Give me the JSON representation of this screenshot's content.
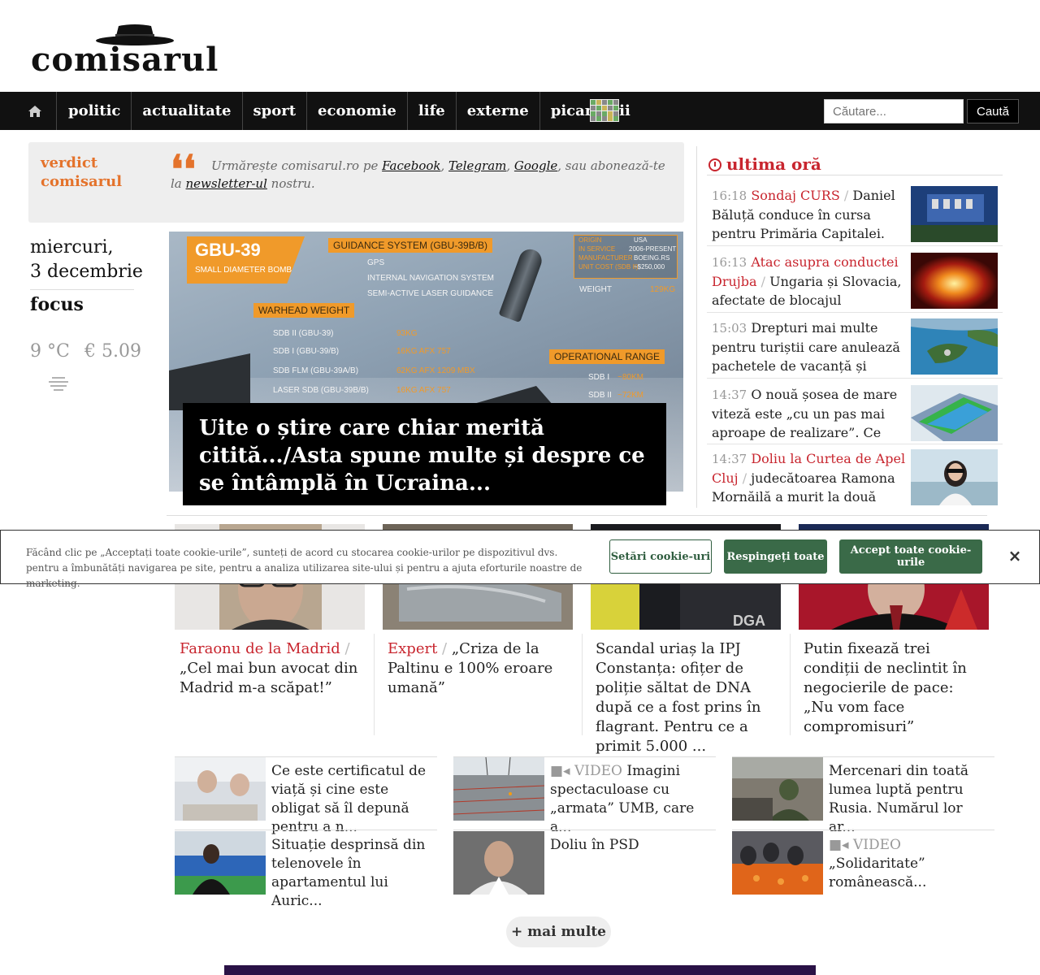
{
  "header": {
    "logo_text": "comisarul"
  },
  "nav": {
    "home_icon": "home-icon",
    "items": [
      "politic",
      "actualitate",
      "sport",
      "economie",
      "life",
      "externe",
      "picanterii"
    ],
    "wordle_icon": "wordle-grid-icon",
    "search_placeholder": "Căutare...",
    "search_button": "Caută"
  },
  "verdict": {
    "title": "verdict comisarul",
    "text_prefix": "Urmărește comisarul.ro pe ",
    "link_facebook": "Facebook",
    "sep1": ", ",
    "link_telegram": "Telegram",
    "sep2": ", ",
    "link_google": "Google",
    "text_mid": ", sau abonează-te la ",
    "link_newsletter": "newsletter-ul",
    "text_suffix": " nostru."
  },
  "sidebar_left": {
    "day": "miercuri,",
    "date": "3 decembrie",
    "focus": "focus",
    "temperature": "9 °C",
    "euro": "€ 5.09",
    "weather_icon": "fog-icon"
  },
  "hero": {
    "caption": "Uite o știre care chiar merită citită.../Asta spune multe și despre ce se întâmplă în Ucraina...",
    "infographic": {
      "title": "GBU-39",
      "subtitle": "SMALL DIAMETER BOMB",
      "guidance": "GUIDANCE SYSTEM (GBU-39B/B)",
      "gps": "GPS",
      "ins": "INTERNAL NAVIGATION SYSTEM",
      "laser": "SEMI-ACTIVE LASER GUIDANCE",
      "warhead": "WARHEAD WEIGHT",
      "sdb2": "SDB II (GBU-39)",
      "sdb1": "SDB I (GBU-39/B)",
      "sdbflm": "SDB FLM (GBU-39A/B)",
      "lasersdb": "LASER SDB (GBU-39B/B)",
      "w1": "93KG",
      "w2": "16KG AFX 757",
      "w3": "62KG AFX 1209 MBX",
      "w4": "16KG AFX 757",
      "range": "OPERATIONAL RANGE",
      "r1": "SDB I",
      "r2": "SDB II",
      "r1v": "~80KM",
      "r2v": "~72KM",
      "origin": "ORIGIN",
      "origin_v": "USA",
      "service": "IN SERVICE",
      "service_v": "2006-PRESENT",
      "manuf": "MANUFACTURER",
      "manuf_v": "BOEING.RS",
      "cost": "UNIT COST (SDB II)",
      "cost_v": "~$250,000",
      "weight": "WEIGHT",
      "weight_v": "129KG"
    }
  },
  "ultima_ora": {
    "title": "ultima oră",
    "items": [
      {
        "time": "16:18",
        "kicker": "Sondaj CURS",
        "text": "Daniel Băluță conduce în cursa pentru Primăria Capitalei. Ciucu și..."
      },
      {
        "time": "16:13",
        "kicker": "Atac asupra conductei Drujba",
        "text": "Ungaria și Slovacia, afectate de blocajul petrolier..."
      },
      {
        "time": "15:03",
        "kicker": "",
        "text": "Drepturi mai multe pentru turiștii care anulează pachetele de vacanță și solicită rambursări"
      },
      {
        "time": "14:37",
        "kicker": "",
        "text": "O nouă șosea de mare viteză este „cu un pas mai aproape de realizare”. Ce mari..."
      },
      {
        "time": "14:37",
        "kicker": "Doliu la Curtea de Apel Cluj",
        "text": "judecătoarea Ramona Mornăilă a murit la două zile..."
      }
    ]
  },
  "cards": [
    {
      "kicker": "Faraonu de la Madrid",
      "text": "„Cel mai bun avocat din Madrid m-a scăpat!”"
    },
    {
      "kicker": "Expert",
      "text": "„Criza de la Paltinu e 100% eroare umană”"
    },
    {
      "kicker": "",
      "text": "Scandal uriaș la IPJ Constanța: ofițer de poliție săltat de DNA după ce a fost prins în flagrant. Pentru ce a primit 5.000 ..."
    },
    {
      "kicker": "",
      "text": "Putin fixează trei condiții de neclintit în negocierile de pace: „Nu vom face compromisuri”"
    }
  ],
  "mini_list": [
    {
      "video": "",
      "text": "Ce este certificatul de viață și cine este obligat să îl depună pentru a n..."
    },
    {
      "video": "VIDEO",
      "text": "Imagini spectaculoase cu „armata” UMB, care a..."
    },
    {
      "video": "",
      "text": "Mercenari din toată lumea luptă pentru Rusia. Numărul lor ar..."
    },
    {
      "video": "",
      "text": "Situație desprinsă din telenovele în apartamentul lui Auric..."
    },
    {
      "video": "",
      "text": "Doliu în PSD"
    },
    {
      "video": "VIDEO",
      "text": "„Solidaritate” românească..."
    }
  ],
  "more_button": "+ mai multe",
  "cookie": {
    "text": "Făcând clic pe „Acceptați toate cookie-urile”, sunteți de acord cu stocarea cookie-urilor pe dispozitivul dvs. pentru a îmbunătăți navigarea pe site, pentru a analiza utilizarea site-ului și pentru a ajuta eforturile noastre de marketing.",
    "settings": "Setări cookie-uri",
    "reject": "Respingeți toate",
    "accept": "Accept toate cookie-urile",
    "close": "×"
  },
  "colors": {
    "accent_red": "#c8252e",
    "accent_orange": "#e4732c",
    "cookie_green": "#3a6a48",
    "nav_bg": "#111111"
  }
}
